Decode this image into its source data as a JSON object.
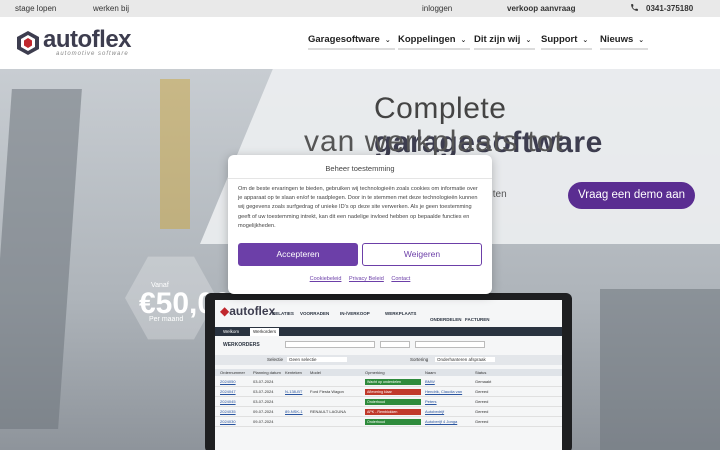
{
  "topbar": {
    "link1": "stage lopen",
    "link2": "werken bij",
    "login": "inloggen",
    "sales": "verkoop aanvraag",
    "phone": "0341-375180"
  },
  "header": {
    "logo_word": "autoflex",
    "logo_sub": "automotive software",
    "nav": [
      "Garagesoftware",
      "Koppelingen",
      "Dit zijn wij",
      "Support",
      "Nieuws"
    ]
  },
  "hero": {
    "headline_light": "Complete ",
    "headline_bold": "garagesoftware",
    "headline2": "van werkplaats tot management",
    "sub_fragment": "iteiten",
    "demo_button": "Vraag een demo aan",
    "price_from": "Vanaf",
    "price_value": "€50,00",
    "price_period": "Per maand"
  },
  "app_preview": {
    "logo": "autoflex",
    "menu": [
      "RELATIES",
      "VOORRADEN",
      "IN-/VERKOOP",
      "WERKPLAATS",
      "ONDERDELEN",
      "FACTUREN"
    ],
    "tabs": [
      "Welkom",
      "Werkorders"
    ],
    "title": "WERKORDERS",
    "filter_label": "Selectie",
    "filter_value": "Geen selectie",
    "sort_label": "Sortering",
    "sort_value": "Onderhanteren afspraak",
    "columns": [
      "Ordernummer",
      "Planning datum",
      "Kenteken",
      "Model",
      "Opmerking",
      "Naam",
      "Status"
    ],
    "rows": [
      {
        "order": "2024050",
        "date": "03-07-2024",
        "plate": "",
        "model": "",
        "note": "Wacht op onderdelen",
        "status_color": "#2e8b3c",
        "name": "BMW",
        "status": "Gemaakt"
      },
      {
        "order": "2024047",
        "date": "03-07-2024",
        "plate": "N-138-BT",
        "model": "Ford Fiesta Wagon",
        "note": "Aflevering klaar",
        "status_color": "#c0392b",
        "name": "Hendrik, Claudia van",
        "status": "Gereed"
      },
      {
        "order": "2024045",
        "date": "03-07-2024",
        "plate": "",
        "model": "",
        "note": "Onderhoud",
        "status_color": "#2e8b3c",
        "name": "Peters",
        "status": "Gereed"
      },
      {
        "order": "2024035",
        "date": "09-07-2024",
        "plate": "89-NSK-1",
        "model": "RENAULT LAGUNA",
        "note": "APK - Remblokken",
        "status_color": "#c0392b",
        "name": "Autobedrijf",
        "status": "Gereed"
      },
      {
        "order": "2024030",
        "date": "09-07-2024",
        "plate": "",
        "model": "",
        "note": "Onderhoud",
        "status_color": "#2e8b3c",
        "name": "Autoberijf 4 Jonga",
        "status": "Gereed"
      }
    ]
  },
  "consent": {
    "title": "Beheer toestemming",
    "body": "Om de beste ervaringen te bieden, gebruiken wij technologieën zoals cookies om informatie over je apparaat op te slaan en/of te raadplegen. Door in te stemmen met deze technologieën kunnen wij gegevens zoals surfgedrag of unieke ID's op deze site verwerken. Als je geen toestemming geeft of uw toestemming intrekt, kan dit een nadelige invloed hebben op bepaalde functies en mogelijkheden.",
    "accept": "Accepteren",
    "decline": "Weigeren",
    "links": [
      "Cookiebeleid",
      "Privacy Beleid",
      "Contact"
    ]
  },
  "colors": {
    "brand_purple": "#5a2d91",
    "consent_purple": "#6c3fa8",
    "brand_red": "#c0272d",
    "navy": "#3d3d4f"
  }
}
